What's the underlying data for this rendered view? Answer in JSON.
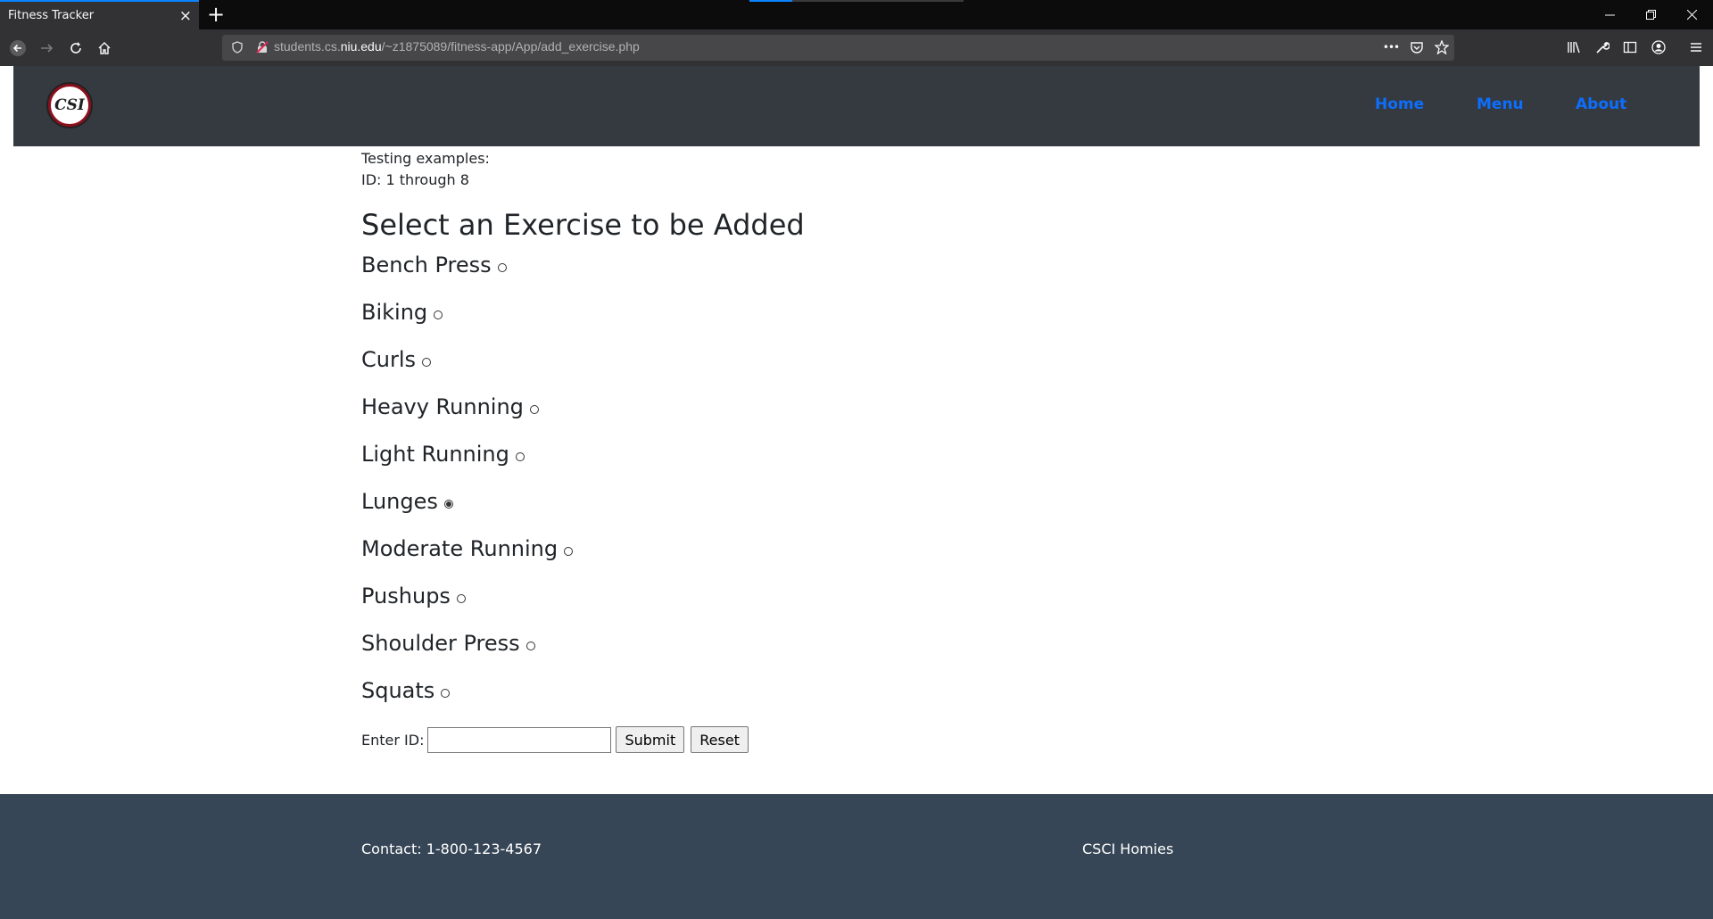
{
  "browser": {
    "tab_title": "Fitness Tracker",
    "tab_close": "×",
    "new_tab": "+",
    "url_prefix": "students.cs.",
    "url_host": "niu.edu",
    "url_path": "/~z1875089/fitness-app/App/add_exercise.php",
    "more": "•••"
  },
  "header": {
    "logo_text": "CSI",
    "nav": [
      "Home",
      "Menu",
      "About"
    ]
  },
  "main": {
    "hint_line1": "Testing examples:",
    "hint_line2": "ID: 1 through 8",
    "heading": "Select an Exercise to be Added",
    "exercises": [
      {
        "label": "Bench Press",
        "checked": false
      },
      {
        "label": "Biking",
        "checked": false
      },
      {
        "label": "Curls",
        "checked": false
      },
      {
        "label": "Heavy Running",
        "checked": false
      },
      {
        "label": "Light Running",
        "checked": false
      },
      {
        "label": "Lunges",
        "checked": true
      },
      {
        "label": "Moderate Running",
        "checked": false
      },
      {
        "label": "Pushups",
        "checked": false
      },
      {
        "label": "Shoulder Press",
        "checked": false
      },
      {
        "label": "Squats",
        "checked": false
      }
    ],
    "id_label": "Enter ID:",
    "id_value": "",
    "submit_label": "Submit",
    "reset_label": "Reset"
  },
  "footer": {
    "contact": "Contact: 1-800-123-4567",
    "team": "CSCI Homies"
  }
}
